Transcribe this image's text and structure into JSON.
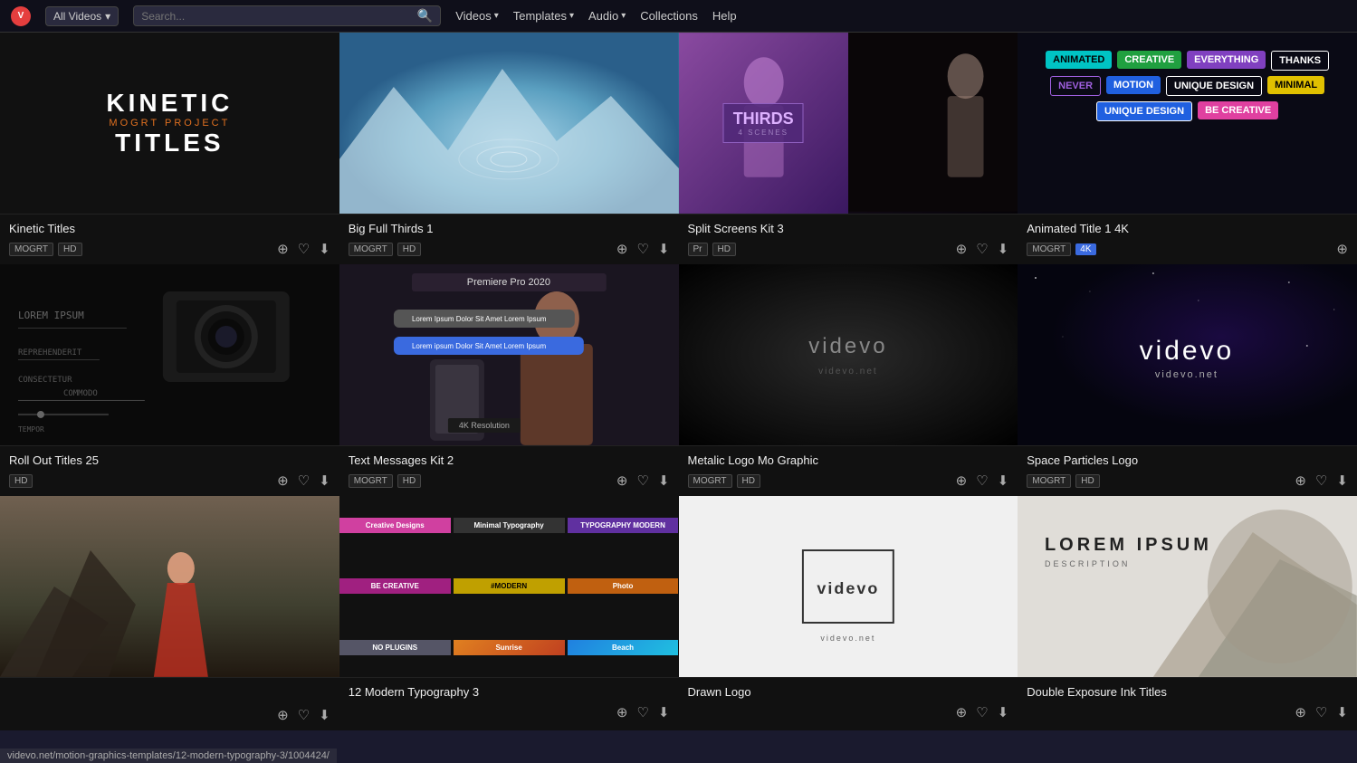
{
  "navbar": {
    "logo_label": "V",
    "filter_label": "All Videos",
    "search_placeholder": "Search...",
    "nav_items": [
      {
        "label": "Videos",
        "has_dropdown": true
      },
      {
        "label": "Templates",
        "has_dropdown": true
      },
      {
        "label": "Audio",
        "has_dropdown": true
      },
      {
        "label": "Collections",
        "has_dropdown": false
      },
      {
        "label": "Help",
        "has_dropdown": false
      }
    ]
  },
  "cards": [
    {
      "id": "kinetic-titles",
      "title": "Kinetic Titles",
      "tags": [
        "MOGRT",
        "HD"
      ],
      "type": "kinetic"
    },
    {
      "id": "big-full-thirds",
      "title": "Big Full Thirds 1",
      "tags": [
        "MOGRT",
        "HD"
      ],
      "type": "landscape"
    },
    {
      "id": "split-screens",
      "title": "Split Screens Kit 3",
      "tags": [
        "Pr",
        "HD"
      ],
      "type": "split"
    },
    {
      "id": "animated-title",
      "title": "Animated Title 1 4K",
      "tags": [
        "MOGRT"
      ],
      "tag_4k": "4K",
      "type": "animated-title"
    },
    {
      "id": "roll-out-titles",
      "title": "Roll Out Titles 25",
      "tags": [
        "HD"
      ],
      "type": "roll"
    },
    {
      "id": "text-messages",
      "title": "Text Messages Kit 2",
      "tags": [
        "MOGRT",
        "HD"
      ],
      "type": "messages"
    },
    {
      "id": "metalic-logo",
      "title": "Metalic Logo Mo Graphic",
      "tags": [
        "MOGRT",
        "HD"
      ],
      "type": "metalic"
    },
    {
      "id": "space-particles",
      "title": "Space Particles Logo",
      "tags": [
        "MOGRT",
        "HD"
      ],
      "type": "space"
    },
    {
      "id": "street-video",
      "title": "",
      "tags": [],
      "type": "street"
    },
    {
      "id": "modern-typography",
      "title": "12 Modern Typography 3",
      "tags": [],
      "type": "typography"
    },
    {
      "id": "drawn-logo",
      "title": "Drawn Logo",
      "tags": [],
      "type": "drawn"
    },
    {
      "id": "double-exposure",
      "title": "Double Exposure Ink Titles",
      "tags": [],
      "type": "double"
    }
  ],
  "kinetic": {
    "line1": "KINETIC",
    "line2": "MOGRT PROJECT",
    "line3": "TITLES"
  },
  "metalic": {
    "main": "videvo",
    "sub": "videvo.net"
  },
  "space": {
    "main": "videvo",
    "sub": "videvo.net"
  },
  "drawn": {
    "main": "videvo",
    "sub": "videvo.net"
  },
  "split": {
    "badge_label": "THIRDS",
    "badge_sub": "4 SCENES"
  },
  "animated_badges": [
    {
      "text": "ANIMATED",
      "cls": "badge-teal"
    },
    {
      "text": "CREATIVE",
      "cls": "badge-green"
    },
    {
      "text": "EVERYTHING",
      "cls": "badge-purple"
    },
    {
      "text": "THANKS",
      "cls": "badge-outline-white"
    },
    {
      "text": "NEVER",
      "cls": "badge-outline-purple"
    },
    {
      "text": "MOTION",
      "cls": "badge-blue"
    },
    {
      "text": "UNIQUE DESIGN",
      "cls": "badge-outline-blue"
    },
    {
      "text": "MINIMAL",
      "cls": "badge-yellow"
    },
    {
      "text": "UNIQUE DESIGN",
      "cls": "badge-pink"
    },
    {
      "text": "BE CREATIVE",
      "cls": "badge-outline-yellow"
    }
  ],
  "messages": {
    "header": "Premiere Pro 2020",
    "bubble1": "Lorem Ipsum Dolor Sit Amet Lorem Ipsum",
    "bubble2": "Lorem ipsum Dolor Sit Amet Lorem Ipsum",
    "res_badge": "4K Resolution"
  },
  "double": {
    "title": "LOREM IPSUM",
    "sub": "DESCRIPTION"
  },
  "url_bar": {
    "text": "videvo.net/motion-graphics-templates/12-modern-typography-3/1004424/"
  }
}
